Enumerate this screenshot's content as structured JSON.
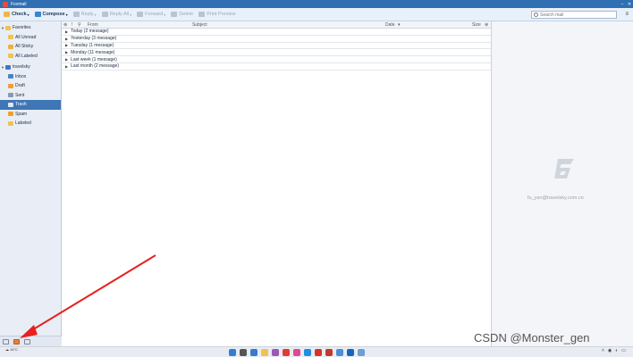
{
  "window": {
    "title": "Foxmail"
  },
  "toolbar": {
    "check": "Check",
    "compose": "Compose",
    "reply": "Reply",
    "reply_all": "Reply All",
    "forward": "Forward",
    "delete": "Delete",
    "print_preview": "Print Preview",
    "search_placeholder": "Search mail"
  },
  "sidebar": {
    "favorites": {
      "label": "Favorites",
      "items": [
        "All Unread",
        "All Sticky",
        "All Labeled"
      ]
    },
    "account": {
      "name": "travelsky",
      "folders": [
        "Inbox",
        "Draft",
        "Sent",
        "Trash",
        "Spam",
        "Labeled"
      ],
      "selected": "Trash"
    }
  },
  "list": {
    "columns": {
      "from": "From",
      "subject": "Subject",
      "date": "Date",
      "size": "Size"
    },
    "groups": [
      "Today (2 message)",
      "Yesterday (3 message)",
      "Tuesday (1 message)",
      "Monday (11 message)",
      "Last week (1 message)",
      "Last month (2 message)"
    ]
  },
  "preview": {
    "credit": "fu_yan@travelsky.com.cn"
  },
  "taskbar": {
    "weather_temp": "16°C"
  },
  "watermark": "CSDN @Monster_gen",
  "colors": {
    "accent": "#3e76b6",
    "titlebar": "#2f6fb2",
    "arrow": "#e5221f"
  }
}
